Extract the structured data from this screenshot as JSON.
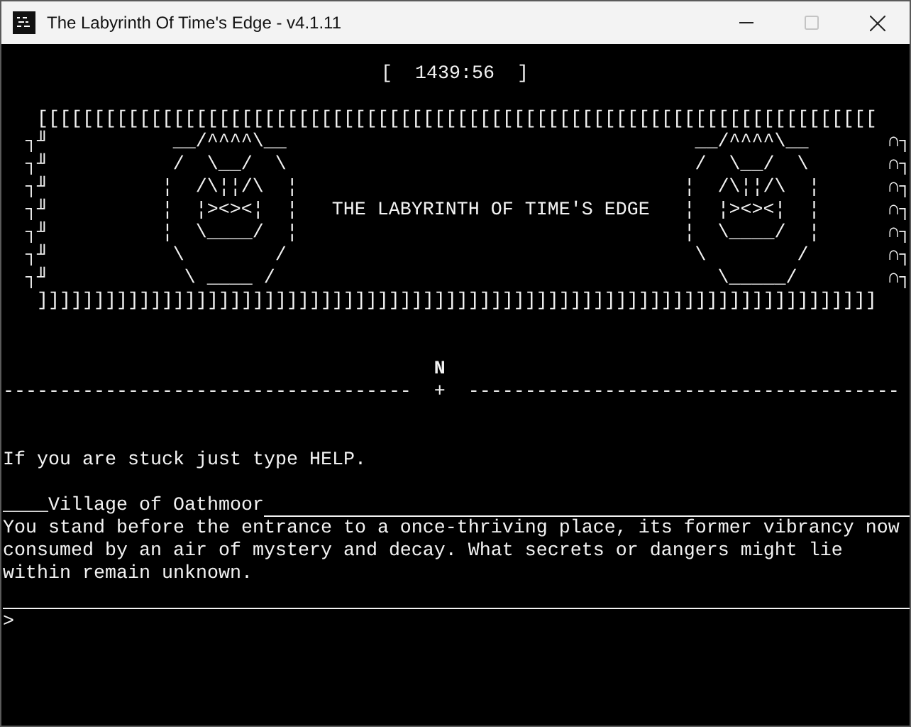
{
  "window": {
    "title": "The Labyrinth Of Time's Edge - v4.1.11",
    "maximize_disabled": true
  },
  "timer": "[  1439:56  ]",
  "banner": {
    "top_edge": "[[[[[[[[[[[[[[[[[[[[[[[[[[[[[[[[[[[[[[[[[[[[[[[[[[[[[[[[[[[[[[[[[[[[[[[[[[",
    "left_edge": [
      "┐╜",
      "┐╜",
      "┐╜",
      "┐╜",
      "┐╜",
      "┐╜",
      "┐╜"
    ],
    "left_clock": [
      " __/^^^^\\__",
      " /  \\__/  \\",
      "¦  /\\¦¦/\\  ¦",
      "¦  ¦><><¦  ¦",
      "¦  \\____/  ¦",
      " \\        /",
      "  \\ ____ /"
    ],
    "title": "THE LABYRINTH OF TIME'S EDGE",
    "right_clock": [
      " __/^^^^\\__",
      " /  \\__/  \\",
      "¦  /\\¦¦/\\  ¦",
      "¦  ¦><><¦  ¦",
      "¦  \\____/  ¦",
      " \\        /",
      "   \\_____/"
    ],
    "right_edge": [
      "∩┐",
      "∩┐",
      "∩┐",
      "∩┐",
      "∩┐",
      "∩┐",
      "∩┐"
    ],
    "bottom_edge": "]]]]]]]]]]]]]]]]]]]]]]]]]]]]]]]]]]]]]]]]]]]]]]]]]]]]]]]]]]]]]]]]]]]]]]]]]]"
  },
  "compass": {
    "north": "N",
    "left_rule": "------------------------------------",
    "center": "+",
    "right_rule": "--------------------------------------"
  },
  "hint": "If you are stuck just type HELP.",
  "location": {
    "heading": "____Village of Oathmoor",
    "description": "You stand before the entrance to a once-thriving place, its former vibrancy now\nconsumed by an air of mystery and decay. What secrets or dangers might lie\nwithin remain unknown."
  },
  "prompt": ">"
}
